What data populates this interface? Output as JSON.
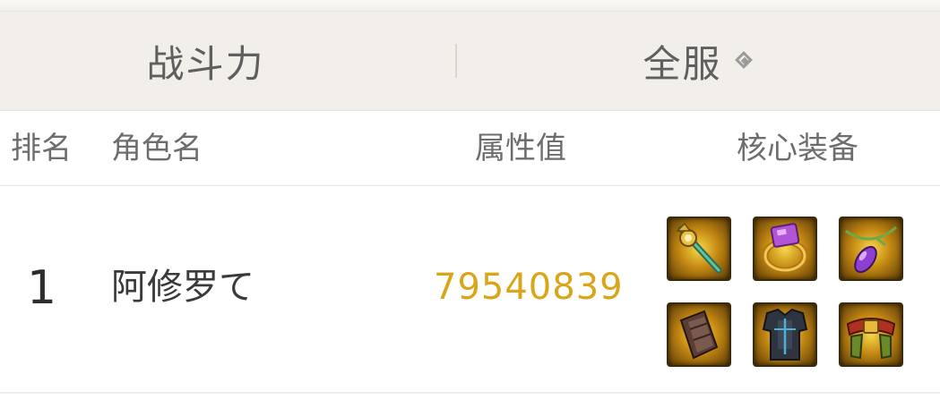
{
  "filters": {
    "category_label": "战斗力",
    "server_label": "全服",
    "server_dropdown_icon": "diamond-dropdown-icon"
  },
  "table": {
    "columns": [
      "排名",
      "角色名",
      "属性值",
      "核心装备"
    ],
    "rows": [
      {
        "rank": "1",
        "name": "阿修罗て",
        "value": "79540839",
        "equipment": [
          "staff-icon",
          "purple-gem-ring-icon",
          "amethyst-necklace-icon",
          "leather-bracer-icon",
          "dark-armor-icon",
          "red-gold-belt-icon"
        ]
      }
    ]
  },
  "colors": {
    "value_gold": "#d9a61a",
    "filter_bg": "#f2efea"
  }
}
